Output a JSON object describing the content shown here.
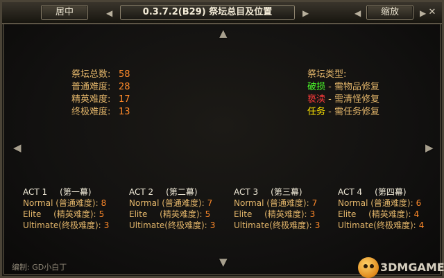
{
  "titlebar": {
    "center_label": "居中",
    "title": "0.3.7.2(B29) 祭坛总目及位置",
    "zoom_label": "缩放",
    "close": "✕",
    "arrow_left": "◀",
    "arrow_right": "▶"
  },
  "nav": {
    "up": "▲",
    "down": "▼",
    "left": "◀",
    "right": "▶"
  },
  "stats": [
    {
      "label": "祭坛总数:",
      "value": "58"
    },
    {
      "label": "普通难度:",
      "value": "28"
    },
    {
      "label": "精英难度:",
      "value": "17"
    },
    {
      "label": "终极难度:",
      "value": "13"
    }
  ],
  "legend": {
    "title": "祭坛类型:",
    "items": [
      {
        "name": "破损",
        "desc": " - 需物品修复",
        "color": "#4cff2a"
      },
      {
        "name": "亵渎",
        "desc": " - 需清怪修复",
        "color": "#ff3b3b"
      },
      {
        "name": "任务",
        "desc": " - 需任务修复",
        "color": "#ffe600"
      }
    ]
  },
  "acts": [
    {
      "title": "ACT 1",
      "subtitle": "(第一幕)",
      "rows": [
        {
          "d1": "Normal",
          "d2": "(普通难度):",
          "v": "8"
        },
        {
          "d1": "Elite",
          "d2": "(精英难度):",
          "v": "5"
        },
        {
          "d1": "Ultimate",
          "d2": "(终极难度):",
          "v": "3"
        }
      ]
    },
    {
      "title": "ACT 2",
      "subtitle": "(第二幕)",
      "rows": [
        {
          "d1": "Normal",
          "d2": "(普通难度):",
          "v": "7"
        },
        {
          "d1": "Elite",
          "d2": "(精英难度):",
          "v": "5"
        },
        {
          "d1": "Ultimate",
          "d2": "(终极难度):",
          "v": "3"
        }
      ]
    },
    {
      "title": "ACT 3",
      "subtitle": "(第三幕)",
      "rows": [
        {
          "d1": "Normal",
          "d2": "(普通难度):",
          "v": "7"
        },
        {
          "d1": "Elite",
          "d2": "(精英难度):",
          "v": "3"
        },
        {
          "d1": "Ultimate",
          "d2": "(终极难度):",
          "v": "3"
        }
      ]
    },
    {
      "title": "ACT 4",
      "subtitle": "(第四幕)",
      "rows": [
        {
          "d1": "Normal",
          "d2": "(普通难度):",
          "v": "6"
        },
        {
          "d1": "Elite",
          "d2": "(精英难度):",
          "v": "4"
        },
        {
          "d1": "Ultimate",
          "d2": "(终极难度):",
          "v": "4"
        }
      ]
    }
  ],
  "credit": "编制: GD小白丁",
  "watermark": "3DMGAME"
}
